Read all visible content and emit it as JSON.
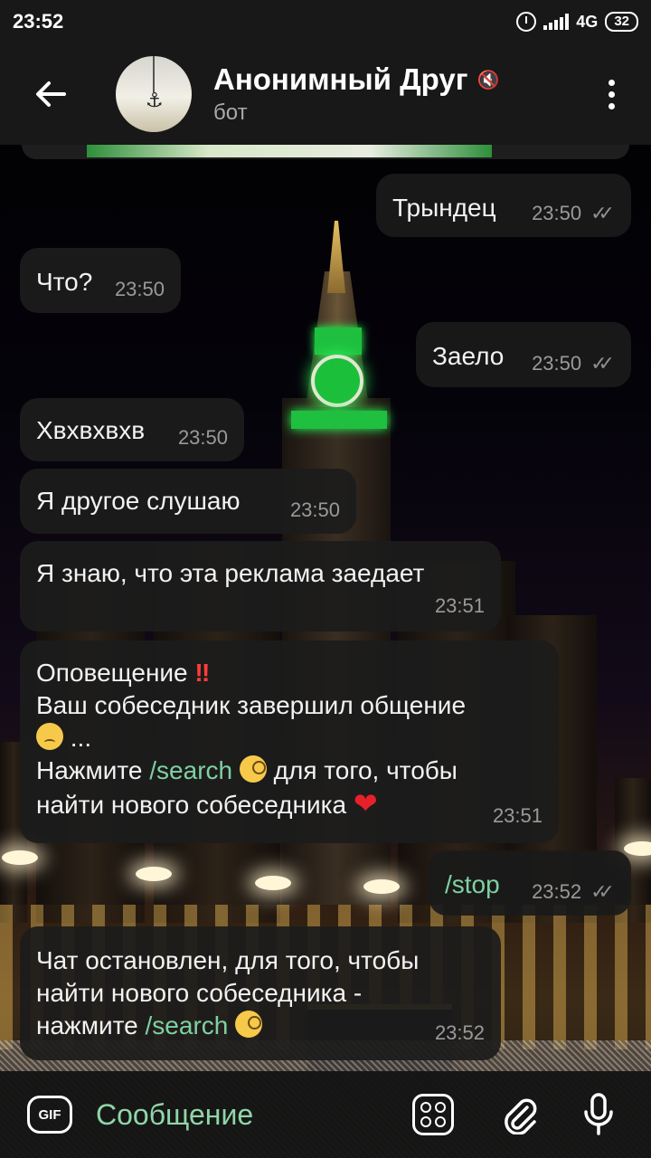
{
  "status_bar": {
    "time": "23:52",
    "network": "4G",
    "battery": "32"
  },
  "header": {
    "title": "Анонимный Друг",
    "subtitle": "бот"
  },
  "messages": [
    {
      "direction": "out",
      "text": "Трындец",
      "time": "23:50",
      "ticks": "✓✓"
    },
    {
      "direction": "in",
      "text": "Что?",
      "time": "23:50"
    },
    {
      "direction": "out",
      "text": "Заело",
      "time": "23:50",
      "ticks": "✓✓"
    },
    {
      "direction": "in",
      "text": "Хвхвхвхв",
      "time": "23:50"
    },
    {
      "direction": "in",
      "text": "Я другое слушаю",
      "time": "23:50"
    },
    {
      "direction": "in",
      "text": "Я знаю, что эта реклама заедает",
      "time": "23:51"
    },
    {
      "direction": "in",
      "line1": "Оповещение",
      "line1_emoji": "‼️",
      "line2": "Ваш собеседник завершил общение",
      "line3_suffix": " ...",
      "line4_prefix": "Нажмите ",
      "line4_link": "/search",
      "line4_suffix": " для того, чтобы",
      "line5": "найти нового собеседника ",
      "time": "23:51"
    },
    {
      "direction": "out",
      "link": "/stop",
      "time": "23:52",
      "ticks": "✓✓"
    },
    {
      "direction": "in",
      "line1": "Чат остановлен, для того, чтобы",
      "line2": "найти нового собеседника -",
      "line3_prefix": "нажмите ",
      "line3_link": "/search",
      "time": "23:52"
    }
  ],
  "composer": {
    "gif_label": "GIF",
    "placeholder": "Сообщение"
  },
  "colors": {
    "link": "#7fd0a2",
    "bubble": "#1c1c1c",
    "placeholder": "#8fd6a8"
  }
}
